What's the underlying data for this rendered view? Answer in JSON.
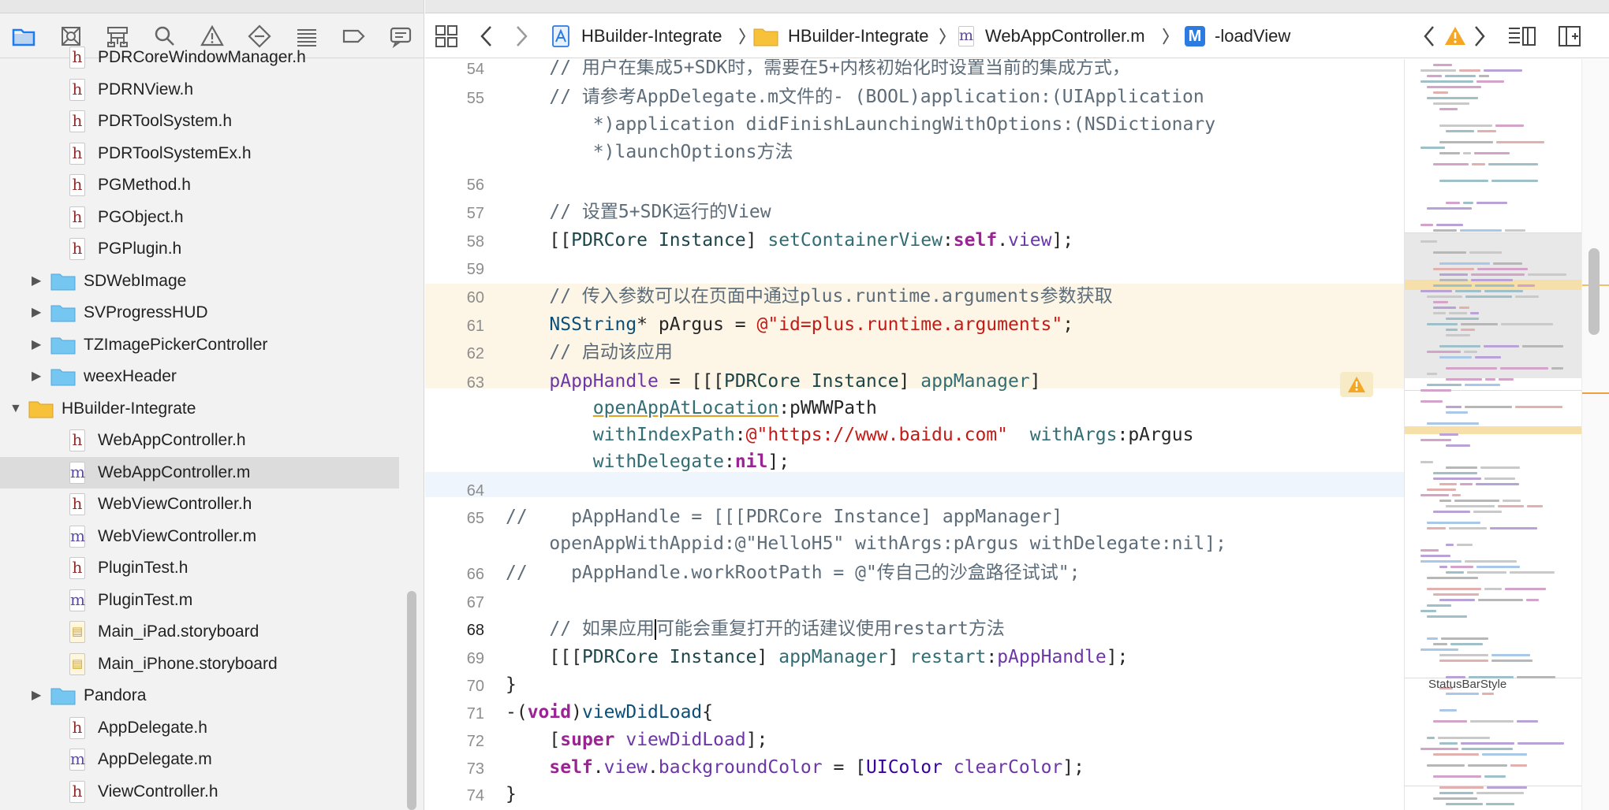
{
  "navigator": {
    "items": [
      {
        "label": "PDRCoreWindowManager.h",
        "kind": "h",
        "depth": 2
      },
      {
        "label": "PDRNView.h",
        "kind": "h",
        "depth": 2
      },
      {
        "label": "PDRToolSystem.h",
        "kind": "h",
        "depth": 2
      },
      {
        "label": "PDRToolSystemEx.h",
        "kind": "h",
        "depth": 2
      },
      {
        "label": "PGMethod.h",
        "kind": "h",
        "depth": 2
      },
      {
        "label": "PGObject.h",
        "kind": "h",
        "depth": 2
      },
      {
        "label": "PGPlugin.h",
        "kind": "h",
        "depth": 2
      },
      {
        "label": "SDWebImage",
        "kind": "folder-blue",
        "depth": 1,
        "collapsed": true
      },
      {
        "label": "SVProgressHUD",
        "kind": "folder-blue",
        "depth": 1,
        "collapsed": true
      },
      {
        "label": "TZImagePickerController",
        "kind": "folder-blue",
        "depth": 1,
        "collapsed": true
      },
      {
        "label": "weexHeader",
        "kind": "folder-blue",
        "depth": 1,
        "collapsed": true
      },
      {
        "label": "HBuilder-Integrate",
        "kind": "folder-yellow",
        "depth": 0,
        "collapsed": false
      },
      {
        "label": "WebAppController.h",
        "kind": "h",
        "depth": 2
      },
      {
        "label": "WebAppController.m",
        "kind": "m",
        "depth": 2,
        "selected": true
      },
      {
        "label": "WebViewController.h",
        "kind": "h",
        "depth": 2
      },
      {
        "label": "WebViewController.m",
        "kind": "m",
        "depth": 2
      },
      {
        "label": "PluginTest.h",
        "kind": "h",
        "depth": 2
      },
      {
        "label": "PluginTest.m",
        "kind": "m",
        "depth": 2
      },
      {
        "label": "Main_iPad.storyboard",
        "kind": "storyboard",
        "depth": 2
      },
      {
        "label": "Main_iPhone.storyboard",
        "kind": "storyboard",
        "depth": 2
      },
      {
        "label": "Pandora",
        "kind": "folder-blue",
        "depth": 1,
        "collapsed": true
      },
      {
        "label": "AppDelegate.h",
        "kind": "h",
        "depth": 2
      },
      {
        "label": "AppDelegate.m",
        "kind": "m",
        "depth": 2
      },
      {
        "label": "ViewController.h",
        "kind": "h",
        "depth": 2
      }
    ],
    "toolbar_icons": [
      "folder-icon",
      "source-control-icon",
      "symbol-icon",
      "search-icon",
      "warning-icon",
      "test-icon",
      "debug-icon",
      "breakpoint-icon",
      "report-icon"
    ]
  },
  "jumpbar": {
    "project": "HBuilder-Integrate",
    "group": "HBuilder-Integrate",
    "file": "WebAppController.m",
    "file_badge": "m",
    "method_badge": "M",
    "method": "-loadView"
  },
  "editor": {
    "current_line": 68,
    "warning_line": 63
  },
  "minimap": {
    "label": "StatusBarStyle"
  },
  "colors": {
    "selection": "#dcdcdc",
    "warning": "#f5a623",
    "folder_blue": "#76c6f2",
    "folder_yellow": "#f8c13a",
    "accent": "#1d7bf0"
  }
}
